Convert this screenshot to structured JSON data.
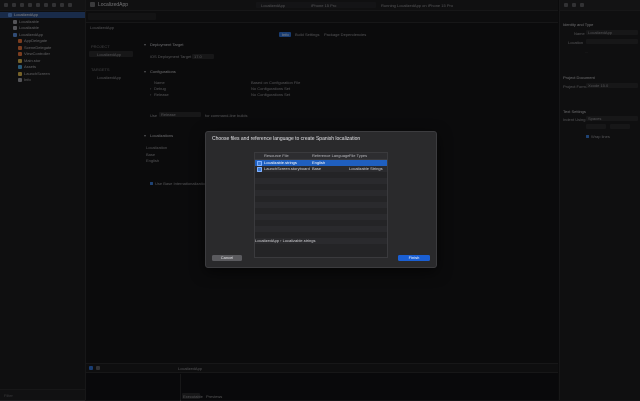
{
  "window": {
    "title": "LocalizedApp",
    "scheme_target": "LocalizedApp",
    "device": "iPhone 15 Pro",
    "status": "Running LocalizedApp on iPhone 15 Pro"
  },
  "navigator": {
    "items": [
      {
        "label": "LocalizedApp",
        "icon": "project-icon",
        "indent": 0,
        "selected": true
      },
      {
        "label": "Localizable",
        "icon": "file-icon",
        "indent": 1
      },
      {
        "label": "Localizable",
        "icon": "file-icon",
        "indent": 1
      },
      {
        "label": "LocalizedApp",
        "icon": "folder-icon",
        "indent": 1
      },
      {
        "label": "AppDelegate",
        "icon": "swift-file-icon",
        "indent": 2
      },
      {
        "label": "SceneDelegate",
        "icon": "swift-file-icon",
        "indent": 2
      },
      {
        "label": "ViewController",
        "icon": "swift-file-icon",
        "indent": 2
      },
      {
        "label": "Main.stor",
        "icon": "storyboard-icon",
        "indent": 2
      },
      {
        "label": "Assets",
        "icon": "assets-icon",
        "indent": 2
      },
      {
        "label": "LaunchScreen",
        "icon": "storyboard-icon",
        "indent": 2
      },
      {
        "label": "Info",
        "icon": "plist-icon",
        "indent": 2
      }
    ],
    "filter_label": "Filter"
  },
  "editor": {
    "breadcrumb": "LocalizedApp",
    "tabs": [
      "Info",
      "Build Settings",
      "Package Dependencies"
    ],
    "project_header": "PROJECT",
    "project_item": "LocalizedApp",
    "targets_header": "TARGETS",
    "target_item": "LocalizedApp",
    "deployment_title": "Deployment Target",
    "deployment_label": "iOS Deployment Target",
    "deployment_value": "17.0",
    "configurations_title": "Configurations",
    "config_header_name": "Name",
    "config_header_based": "Based on Configuration File",
    "config_rows": [
      {
        "name": "Debug",
        "based": "No Configurations Set"
      },
      {
        "name": "Release",
        "based": "No Configurations Set"
      }
    ],
    "use_label": "Use",
    "use_value": "Release",
    "use_suffix": "for command-line builds",
    "localizations_title": "Localizations",
    "loc_header": "Localization",
    "loc_rows": [
      "Base",
      "English"
    ],
    "base_intl_label": "Use Base Internationalization"
  },
  "inspector": {
    "identity_title": "Identity and Type",
    "name_label": "Name",
    "name_value": "LocalizedApp",
    "location_label": "Location",
    "document_title": "Project Document",
    "format_label": "Project Format",
    "format_value": "Xcode 15.0",
    "text_settings_title": "Text Settings",
    "indent_label": "Indent Using",
    "indent_value": "Spaces",
    "wrap_label": "Wrap lines"
  },
  "debug": {
    "scheme": "LocalizedApp",
    "segments": [
      "Executable",
      "Previews"
    ]
  },
  "dialog": {
    "title": "Choose files and reference language to create Spanish localization",
    "columns": [
      "Resource File",
      "Reference Language",
      "File Types"
    ],
    "rows": [
      {
        "file": "Localizable.strings",
        "language": "English",
        "type": "",
        "checked": true,
        "selected": true
      },
      {
        "file": "LaunchScreen.storyboard",
        "language": "Base",
        "type": "Localizable Strings",
        "checked": true,
        "selected": false
      }
    ],
    "footer_path": "LocalizedApp › Localizable.strings",
    "cancel_label": "Cancel",
    "finish_label": "Finish"
  },
  "colors": {
    "accent": "#1f5fbf",
    "finish_button": "#1a5fd4"
  }
}
